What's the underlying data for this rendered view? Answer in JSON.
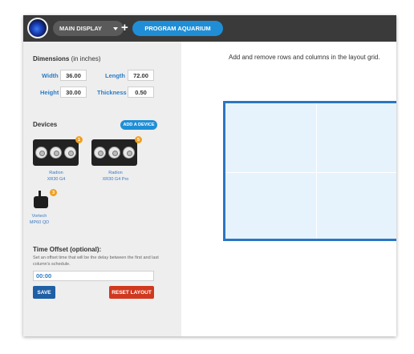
{
  "header": {
    "display_select": "MAIN DISPLAY",
    "add_symbol": "+",
    "program_button": "PROGRAM AQUARIUM"
  },
  "dimensions": {
    "title": "Dimensions",
    "unit_note": "(in inches)",
    "width_label": "Width",
    "width_value": "36.00",
    "length_label": "Length",
    "length_value": "72.00",
    "height_label": "Height",
    "height_value": "30.00",
    "thickness_label": "Thickness",
    "thickness_value": "0.50"
  },
  "devices": {
    "title": "Devices",
    "add_button": "ADD A DEVICE",
    "items": [
      {
        "line1": "Radion",
        "line2": "XR30 G4",
        "badge": "1"
      },
      {
        "line1": "Radion",
        "line2": "XR30 G4 Pro",
        "badge": "5"
      },
      {
        "line1": "Vortech",
        "line2": "MP60 QD",
        "badge": "3"
      }
    ]
  },
  "time_offset": {
    "title": "Time Offset (optional):",
    "description": "Set an offset time that will be the delay between the first and last column's schedule.",
    "value": "00:00"
  },
  "actions": {
    "save": "SAVE",
    "reset": "RESET LAYOUT"
  },
  "main": {
    "instruction": "Add and remove rows and columns in the layout grid."
  },
  "colors": {
    "accent": "#1f8ed6",
    "grid_border": "#2b76c2",
    "grid_fill": "#e6f3fd",
    "reset": "#d0391f",
    "badge": "#f0a020"
  }
}
